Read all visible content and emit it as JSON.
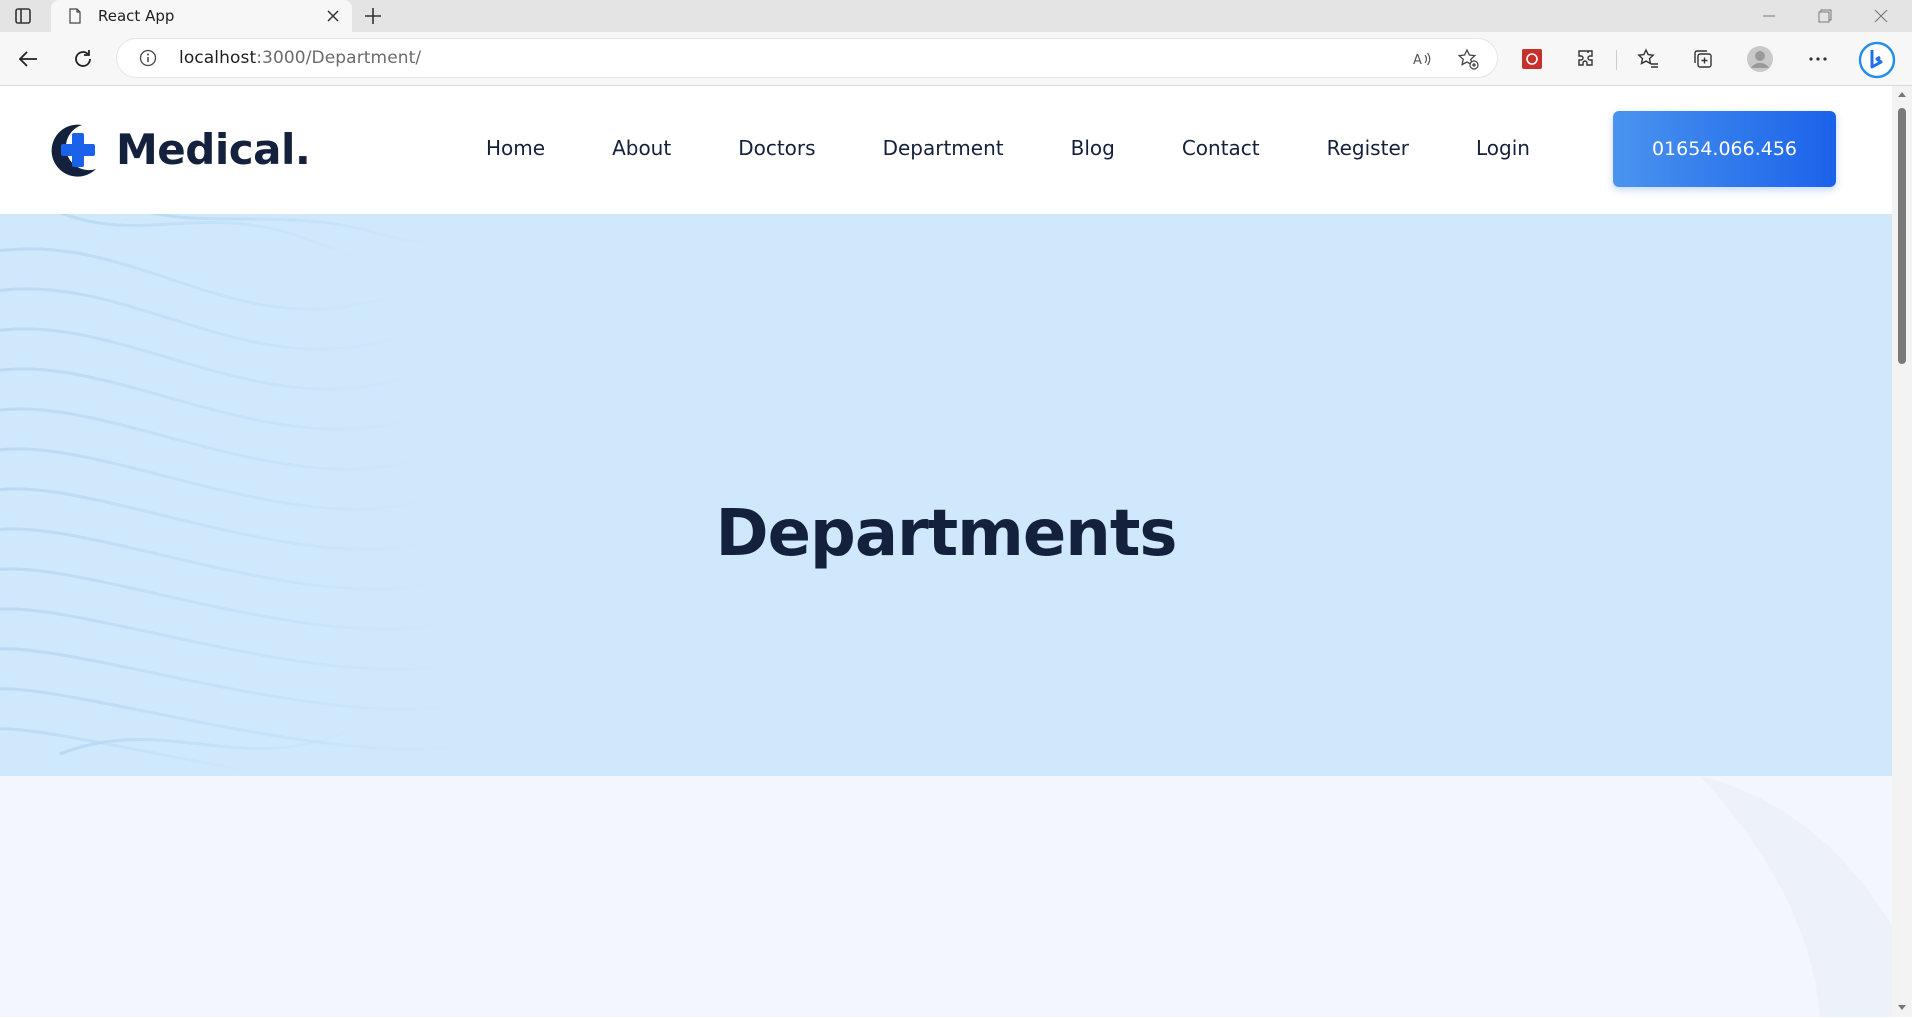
{
  "browser": {
    "tab_title": "React App",
    "url_host": "localhost",
    "url_path": ":3000/Department/"
  },
  "site": {
    "logo_text": "Medical.",
    "nav": [
      "Home",
      "About",
      "Doctors",
      "Department",
      "Blog",
      "Contact",
      "Register",
      "Login"
    ],
    "phone": "01654.066.456",
    "brand_color": "#1b62ea",
    "text_color": "#14213d"
  },
  "hero": {
    "title": "Departments",
    "background": "#cfe8fc"
  }
}
